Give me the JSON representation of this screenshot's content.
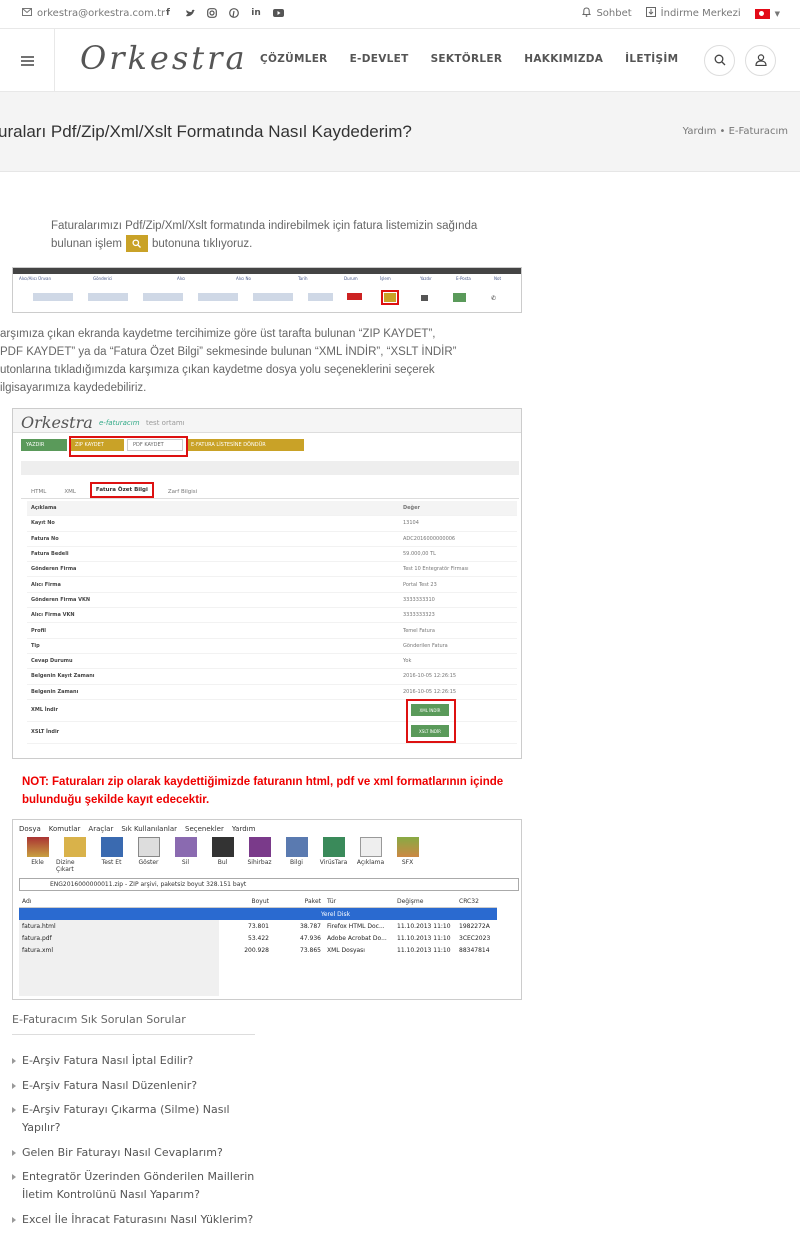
{
  "topbar": {
    "email": "orkestra@orkestra.com.tr",
    "social_icons": [
      "facebook-icon",
      "twitter-icon",
      "instagram-icon",
      "pinterest-icon",
      "linkedin-icon",
      "youtube-icon"
    ],
    "chat_label": "Sohbet",
    "download_label": "İndirme Merkezi",
    "language": "TR"
  },
  "header": {
    "logo": "Orkestra",
    "nav": [
      "ÇÖZÜMLER",
      "E-DEVLET",
      "SEKTÖRLER",
      "HAKKIMIZDA",
      "İLETİŞİM"
    ]
  },
  "page": {
    "title": "uraları Pdf/Zip/Xml/Xslt Formatında Nasıl Kaydederim?",
    "breadcrumb": "Yardım • E-Faturacım"
  },
  "content": {
    "para1_a": "Faturalarımızı Pdf/Zip/Xml/Xslt formatında indirebilmek için fatura listemizin sağında",
    "para1_b": "bulunan işlem",
    "para1_c": "butonuna tıklıyoruz.",
    "para2": [
      "arşımıza çıkan ekranda kaydetme tercihimize göre üst tarafta bulunan “ZIP KAYDET”,",
      "PDF KAYDET” ya da “Fatura Özet Bilgi” sekmesinde bulunan “XML İNDİR”, “XSLT İNDİR”",
      "utonlarına tıkladığımızda karşımıza çıkan kaydetme dosya yolu seçeneklerini seçerek",
      "ilgisayarımıza kaydedebiliriz."
    ],
    "note": "NOT: Faturaları zip olarak kaydettiğimizde faturanın html, pdf ve xml formatlarının içinde bulunduğu şekilde kayıt edecektir."
  },
  "screenshot1": {
    "headers": [
      "Alıcı/Alıcı Ünvan",
      "Gönderici",
      "Alıcı",
      "Alıcı No",
      "Tarih",
      "Durum",
      "İşlem",
      "Yazdır",
      "E-Posta",
      "Not"
    ]
  },
  "screenshot2": {
    "logo": "Orkestra",
    "sub": "e-faturacım",
    "test": "test ortamı",
    "buttons": [
      "YAZDIR",
      "ZIP KAYDET",
      "PDF KAYDET",
      "E-FATURA LİSTESİNE DÖNDÜR"
    ],
    "tabs": [
      "HTML",
      "XML",
      "Fatura Özet Bilgi",
      "Zarf Bilgisi"
    ],
    "col_key": "Açıklama",
    "col_val": "Değer",
    "rows": [
      [
        "Kayıt No",
        "13104"
      ],
      [
        "Fatura No",
        "ADC2016000000006"
      ],
      [
        "Fatura Bedeli",
        "59.000,00 TL"
      ],
      [
        "Gönderen Firma",
        "Test 10 Entegratör Firması"
      ],
      [
        "Alıcı Firma",
        "Portal Test 23"
      ],
      [
        "Gönderen Firma VKN",
        "3333333310"
      ],
      [
        "Alıcı Firma VKN",
        "3333333323"
      ],
      [
        "Profil",
        "Temel Fatura"
      ],
      [
        "Tip",
        "Gönderilen Fatura"
      ],
      [
        "Cevap Durumu",
        "Yok"
      ],
      [
        "Belgenin Kayıt Zamanı",
        "2016-10-05 12:26:15"
      ],
      [
        "Belgenin Zamanı",
        "2016-10-05 12:26:15"
      ]
    ],
    "xml_label": "XML İndir",
    "xslt_label": "XSLT İndir",
    "xml_btn": "XML İNDİR",
    "xslt_btn": "XSLT İNDİR"
  },
  "screenshot3": {
    "menu": [
      "Dosya",
      "Komutlar",
      "Araçlar",
      "Sık Kullanılanlar",
      "Seçenekler",
      "Yardım"
    ],
    "tools": [
      "Ekle",
      "Dizine Çıkart",
      "Test Et",
      "Göster",
      "Sil",
      "Bul",
      "Sihirbaz",
      "Bilgi",
      "VirüsTara",
      "Açıklama",
      "SFX"
    ],
    "path": "ENG2016000000011.zip - ZIP arşivi, paketsiz boyut 328.151 bayt",
    "headers": [
      "Adı",
      "Boyut",
      "Paket",
      "Tür",
      "Değişme",
      "CRC32"
    ],
    "folder_row": "Yerel Disk",
    "files": [
      [
        "fatura.html",
        "73.801",
        "38.787",
        "Firefox HTML Doc...",
        "11.10.2013 11:10",
        "1982272A"
      ],
      [
        "fatura.pdf",
        "53.422",
        "47.936",
        "Adobe Acrobat Do...",
        "11.10.2013 11:10",
        "3CEC2023"
      ],
      [
        "fatura.xml",
        "200.928",
        "73.865",
        "XML Dosyası",
        "11.10.2013 11:10",
        "88347814"
      ]
    ]
  },
  "faq": {
    "title": "E-Faturacım Sık Sorulan Sorular",
    "items": [
      "E-Arşiv Fatura Nasıl İptal Edilir?",
      "E-Arşiv Fatura Nasıl Düzenlenir?",
      "E-Arşiv Faturayı Çıkarma (Silme) Nasıl Yapılır?",
      "Gelen Bir Faturayı Nasıl Cevaplarım?",
      "Entegratör Üzerinden Gönderilen Maillerin İletim Kontrolünü Nasıl Yaparım?",
      "Excel İle İhracat Faturasını Nasıl Yüklerim?"
    ]
  }
}
